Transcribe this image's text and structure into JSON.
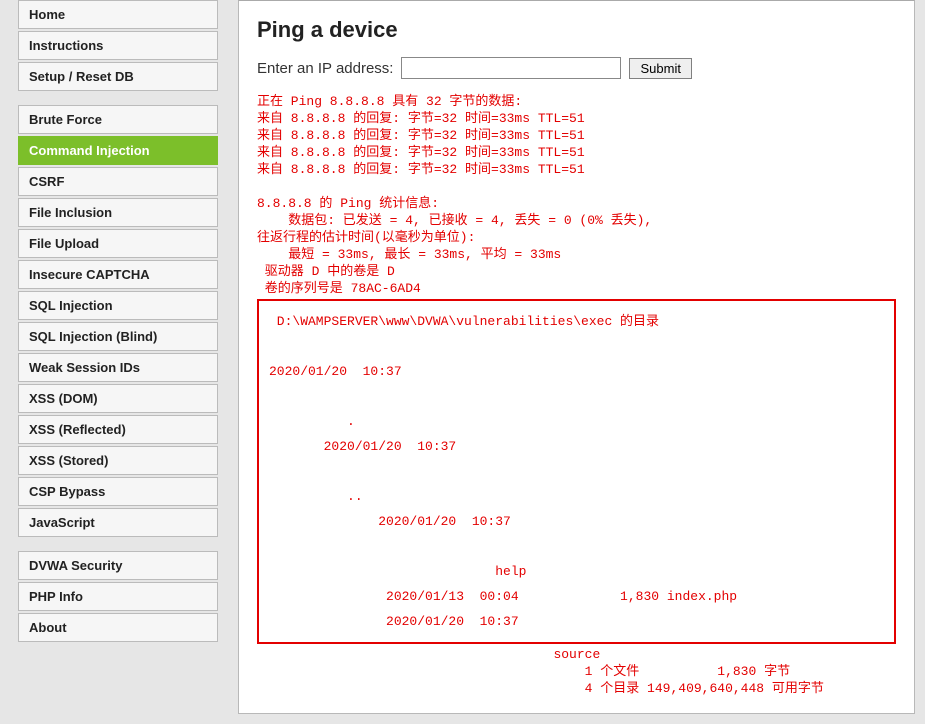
{
  "sidebar": {
    "group1": [
      {
        "label": "Home"
      },
      {
        "label": "Instructions"
      },
      {
        "label": "Setup / Reset DB"
      }
    ],
    "group2": [
      {
        "label": "Brute Force"
      },
      {
        "label": "Command Injection",
        "active": true
      },
      {
        "label": "CSRF"
      },
      {
        "label": "File Inclusion"
      },
      {
        "label": "File Upload"
      },
      {
        "label": "Insecure CAPTCHA"
      },
      {
        "label": "SQL Injection"
      },
      {
        "label": "SQL Injection (Blind)"
      },
      {
        "label": "Weak Session IDs"
      },
      {
        "label": "XSS (DOM)"
      },
      {
        "label": "XSS (Reflected)"
      },
      {
        "label": "XSS (Stored)"
      },
      {
        "label": "CSP Bypass"
      },
      {
        "label": "JavaScript"
      }
    ],
    "group3": [
      {
        "label": "DVWA Security"
      },
      {
        "label": "PHP Info"
      },
      {
        "label": "About"
      }
    ]
  },
  "main": {
    "heading": "Ping a device",
    "form": {
      "label": "Enter an IP address:",
      "input_value": "",
      "submit_label": "Submit"
    },
    "output_pre": "正在 Ping 8.8.8.8 具有 32 字节的数据:\n来自 8.8.8.8 的回复: 字节=32 时间=33ms TTL=51\n来自 8.8.8.8 的回复: 字节=32 时间=33ms TTL=51\n来自 8.8.8.8 的回复: 字节=32 时间=33ms TTL=51\n来自 8.8.8.8 的回复: 字节=32 时间=33ms TTL=51\n\n8.8.8.8 的 Ping 统计信息:\n    数据包: 已发送 = 4, 已接收 = 4, 丢失 = 0 (0% 丢失),\n往返行程的估计时间(以毫秒为单位):\n    最短 = 33ms, 最长 = 33ms, 平均 = 33ms\n 驱动器 D 中的卷是 D\n 卷的序列号是 78AC-6AD4",
    "output_box": " D:\\WAMPSERVER\\www\\DVWA\\vulnerabilities\\exec 的目录\n\n2020/01/20  10:37\n\n          .\n       2020/01/20  10:37\n\n          ..\n              2020/01/20  10:37\n\n                             help\n               2020/01/13  00:04             1,830 index.php\n               2020/01/20  10:37",
    "output_post": "                                      source\n                                          1 个文件          1,830 字节\n                                          4 个目录 149,409,640,448 可用字节"
  }
}
